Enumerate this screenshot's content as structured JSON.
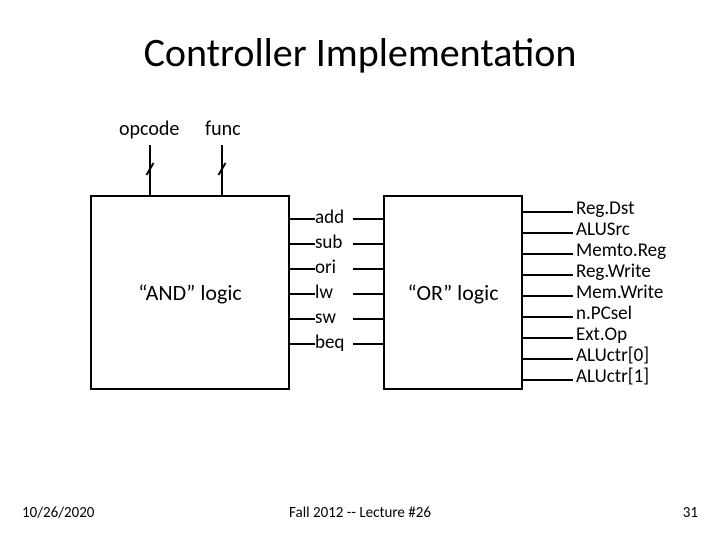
{
  "title": "Controller Implementation",
  "inputs": {
    "opcode": "opcode",
    "func": "func"
  },
  "boxes": {
    "and": "“AND” logic",
    "or": "“OR” logic"
  },
  "signals": [
    "add",
    "sub",
    "ori",
    "lw",
    "sw",
    "beq"
  ],
  "outputs": [
    "Reg.Dst",
    "ALUSrc",
    "Memto.Reg",
    "Reg.Write",
    "Mem.Write",
    "n.PCsel",
    "Ext.Op",
    "ALUctr[0]",
    "ALUctr[1]"
  ],
  "footer": {
    "date": "10/26/2020",
    "center": "Fall 2012 -- Lecture #26",
    "page": "31"
  }
}
